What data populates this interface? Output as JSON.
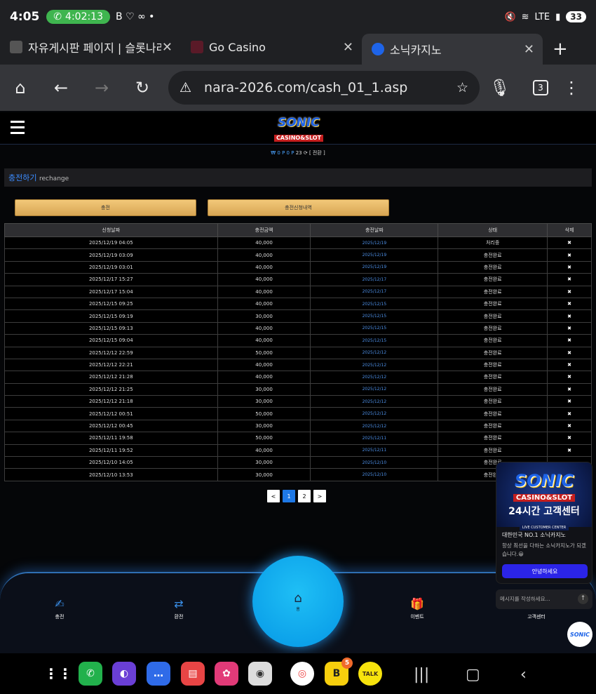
{
  "status": {
    "time": "4:05",
    "call_timer": "4:02:13",
    "battery": "33",
    "network": "LTE"
  },
  "tabs": [
    {
      "title": "자유게시판 페이지 | 슬롯나라",
      "favicon_color": "#666"
    },
    {
      "title": "Go Casino",
      "favicon_color": "#5a1a28"
    },
    {
      "title": "소닉카지노",
      "favicon_color": "#1e64e8"
    }
  ],
  "omnibox": {
    "url": "nara-2026.com/cash_01_1.asp",
    "tab_count": "3"
  },
  "site": {
    "logo_main": "SONIC",
    "logo_sub": "CASINO&SLOT",
    "balance": {
      "won": "₩ 0",
      "point": "P 0 P",
      "count": "23",
      "refresh_label": "[ 전환 ]"
    },
    "section_title_ko": "충전하기",
    "section_title_en": "rechange",
    "btn_charge": "충전",
    "btn_history": "충전신청내역"
  },
  "table": {
    "headers": [
      "신청날짜",
      "충전금액",
      "충전날짜",
      "상태",
      "삭제"
    ],
    "rows": [
      [
        "2025/12/19 04:05",
        "40,000",
        "2025/12/19",
        "처리중",
        "✖"
      ],
      [
        "2025/12/19 03:09",
        "40,000",
        "2025/12/19",
        "충전완료",
        "✖"
      ],
      [
        "2025/12/19 03:01",
        "40,000",
        "2025/12/19",
        "충전완료",
        "✖"
      ],
      [
        "2025/12/17 15:27",
        "40,000",
        "2025/12/17",
        "충전완료",
        "✖"
      ],
      [
        "2025/12/17 15:04",
        "40,000",
        "2025/12/17",
        "충전완료",
        "✖"
      ],
      [
        "2025/12/15 09:25",
        "40,000",
        "2025/12/15",
        "충전완료",
        "✖"
      ],
      [
        "2025/12/15 09:19",
        "30,000",
        "2025/12/15",
        "충전완료",
        "✖"
      ],
      [
        "2025/12/15 09:13",
        "40,000",
        "2025/12/15",
        "충전완료",
        "✖"
      ],
      [
        "2025/12/15 09:04",
        "40,000",
        "2025/12/15",
        "충전완료",
        "✖"
      ],
      [
        "2025/12/12 22:59",
        "50,000",
        "2025/12/12",
        "충전완료",
        "✖"
      ],
      [
        "2025/12/12 22:21",
        "40,000",
        "2025/12/12",
        "충전완료",
        "✖"
      ],
      [
        "2025/12/12 21:28",
        "40,000",
        "2025/12/12",
        "충전완료",
        "✖"
      ],
      [
        "2025/12/12 21:25",
        "30,000",
        "2025/12/12",
        "충전완료",
        "✖"
      ],
      [
        "2025/12/12 21:18",
        "30,000",
        "2025/12/12",
        "충전완료",
        "✖"
      ],
      [
        "2025/12/12 00:51",
        "50,000",
        "2025/12/12",
        "충전완료",
        "✖"
      ],
      [
        "2025/12/12 00:45",
        "30,000",
        "2025/12/12",
        "충전완료",
        "✖"
      ],
      [
        "2025/12/11 19:58",
        "50,000",
        "2025/12/11",
        "충전완료",
        "✖"
      ],
      [
        "2025/12/11 19:52",
        "40,000",
        "2025/12/11",
        "충전완료",
        "✖"
      ],
      [
        "2025/12/10 14:05",
        "30,000",
        "2025/12/10",
        "충전완료",
        ""
      ],
      [
        "2025/12/10 13:53",
        "30,000",
        "2025/12/10",
        "충전완료",
        ""
      ]
    ]
  },
  "pager": {
    "prev": "<",
    "pages": [
      "1",
      "2"
    ],
    "next": ">",
    "current": "1"
  },
  "bottom_nav": {
    "charge": "충전",
    "exchange": "환전",
    "home": "홈",
    "event": "이벤트",
    "support": "고객센터"
  },
  "chat": {
    "banner_main": "SONIC",
    "banner_sub": "CASINO&SLOT",
    "banner_title": "24시간 고객센터",
    "banner_caption": "LIVE CUSTOMER CENTER",
    "title": "대한민국 NO.1 소닉카지노",
    "message": "항상 최선을 다하는 소닉카지노가 되겠습니다.😀",
    "button": "안녕하세요",
    "input_placeholder": "메시지를 작성하세요..."
  },
  "dock": {
    "badge_count": "5",
    "kakao_label": "TALK"
  }
}
